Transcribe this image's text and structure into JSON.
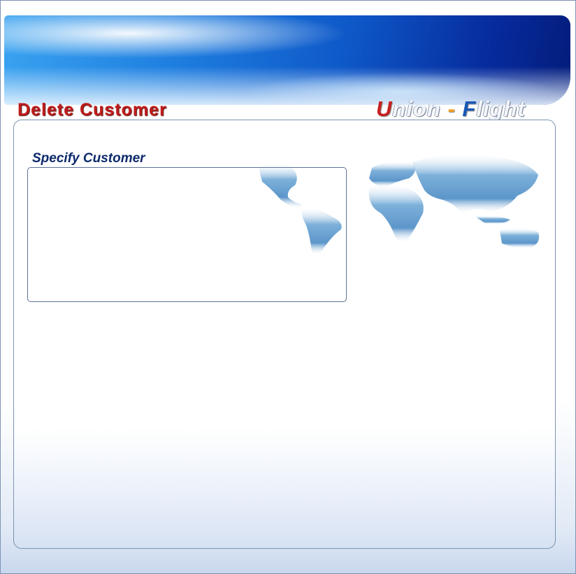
{
  "page": {
    "title": "Delete Customer",
    "brand": {
      "u": "U",
      "nion": "nion",
      "dash": "-",
      "f": "F",
      "light": "light"
    }
  },
  "specify_group": {
    "label": "Specify Customer"
  }
}
